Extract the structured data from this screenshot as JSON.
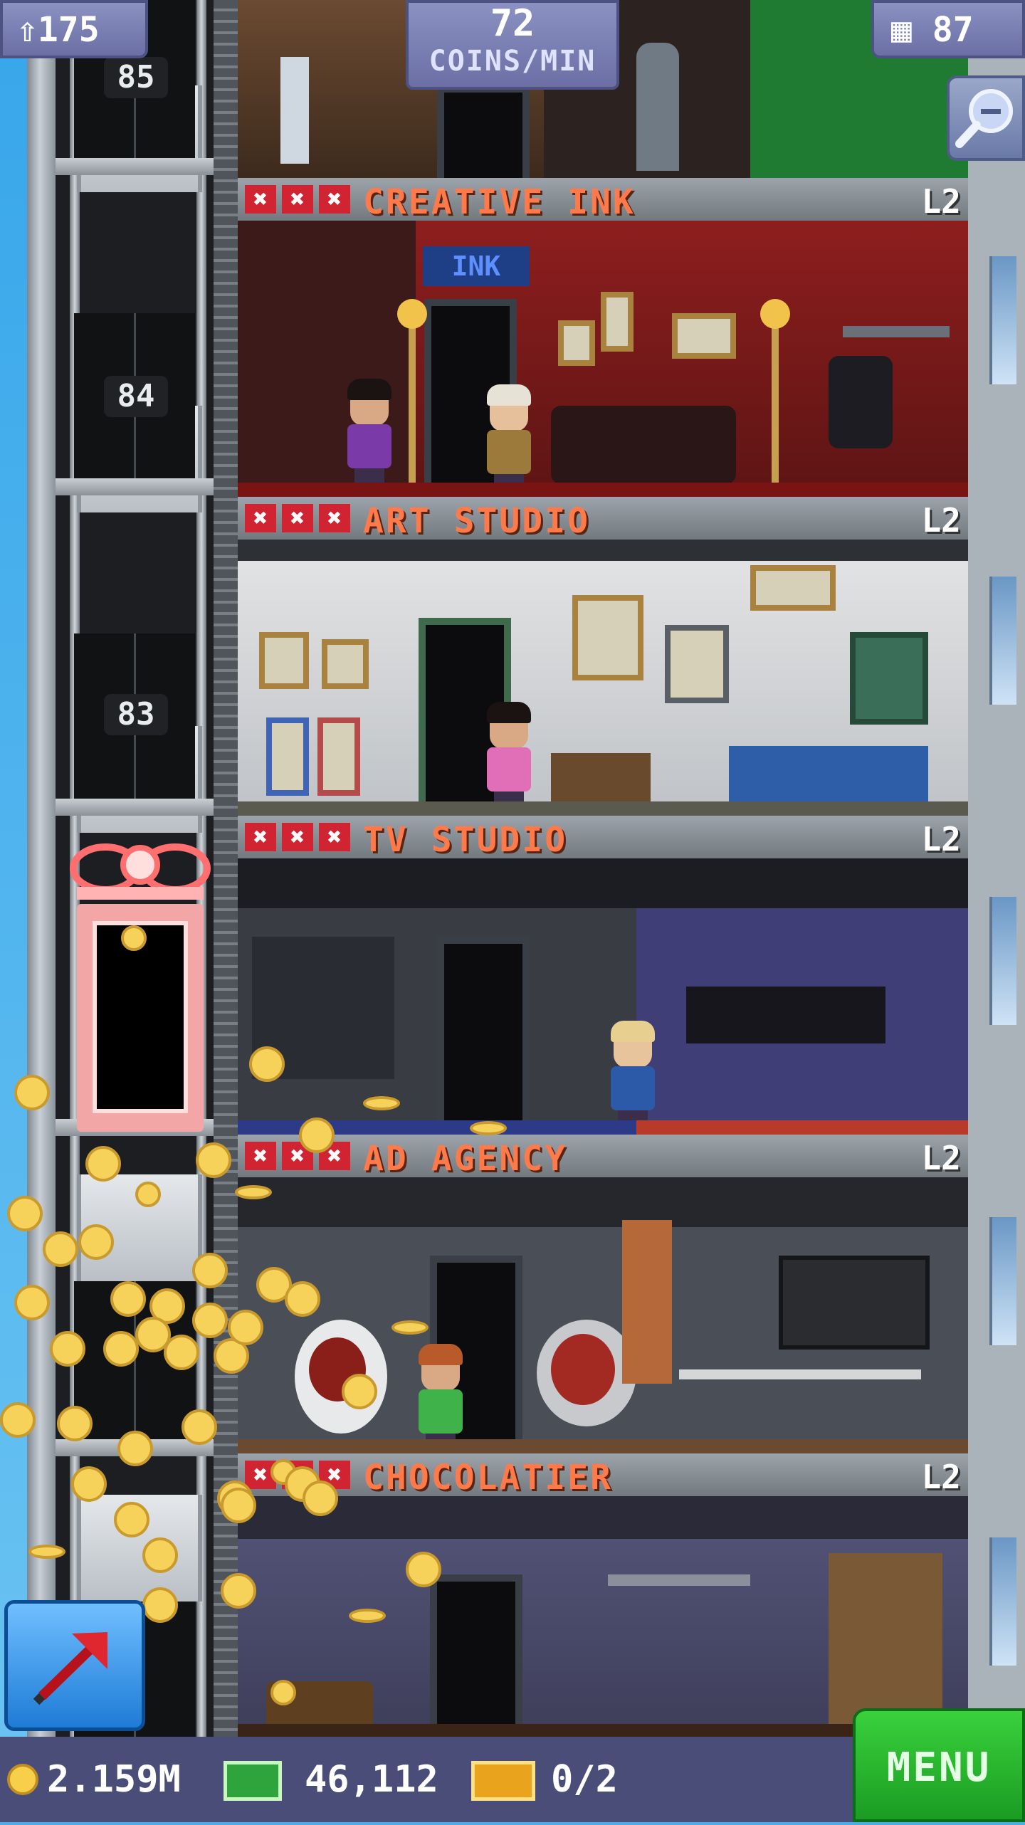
{
  "hud": {
    "population": "175",
    "coins_per_min_value": "72",
    "coins_per_min_label": "COINS/MIN",
    "floor_count": "87"
  },
  "elevator": {
    "floor_numbers": [
      "85",
      "84",
      "83"
    ]
  },
  "rooms": [
    {
      "name": "CREATIVE INK",
      "level": "L2",
      "x_marks": [
        "✖",
        "✖",
        "✖"
      ],
      "wall_sign": "INK"
    },
    {
      "name": "ART STUDIO",
      "level": "L2",
      "x_marks": [
        "✖",
        "✖",
        "✖"
      ]
    },
    {
      "name": "TV STUDIO",
      "level": "L2",
      "x_marks": [
        "✖",
        "✖",
        "✖"
      ]
    },
    {
      "name": "AD AGENCY",
      "level": "L2",
      "x_marks": [
        "✖",
        "✖",
        "✖"
      ]
    },
    {
      "name": "CHOCOLATIER",
      "level": "L2",
      "x_marks": [
        "✖",
        "✖",
        "✖"
      ]
    }
  ],
  "bottom_bar": {
    "coins": "2.159M",
    "tower_bux": "46,112",
    "tickets": "0/2",
    "menu_label": "MENU"
  },
  "icons": {
    "population": "person-up-icon",
    "floors": "building-icon",
    "zoom": "zoom-out-magnifier-icon",
    "share": "red-arrow-icon",
    "coin": "coin-icon",
    "bux": "tower-bux-icon",
    "ticket": "ticket-icon"
  },
  "colors": {
    "room_title": "#ff7a4a",
    "x_mark": "#d12432",
    "hud_pill": "#7a7fb4",
    "menu_green": "#2bbd32",
    "bottom_bar": "#4a4d77"
  }
}
